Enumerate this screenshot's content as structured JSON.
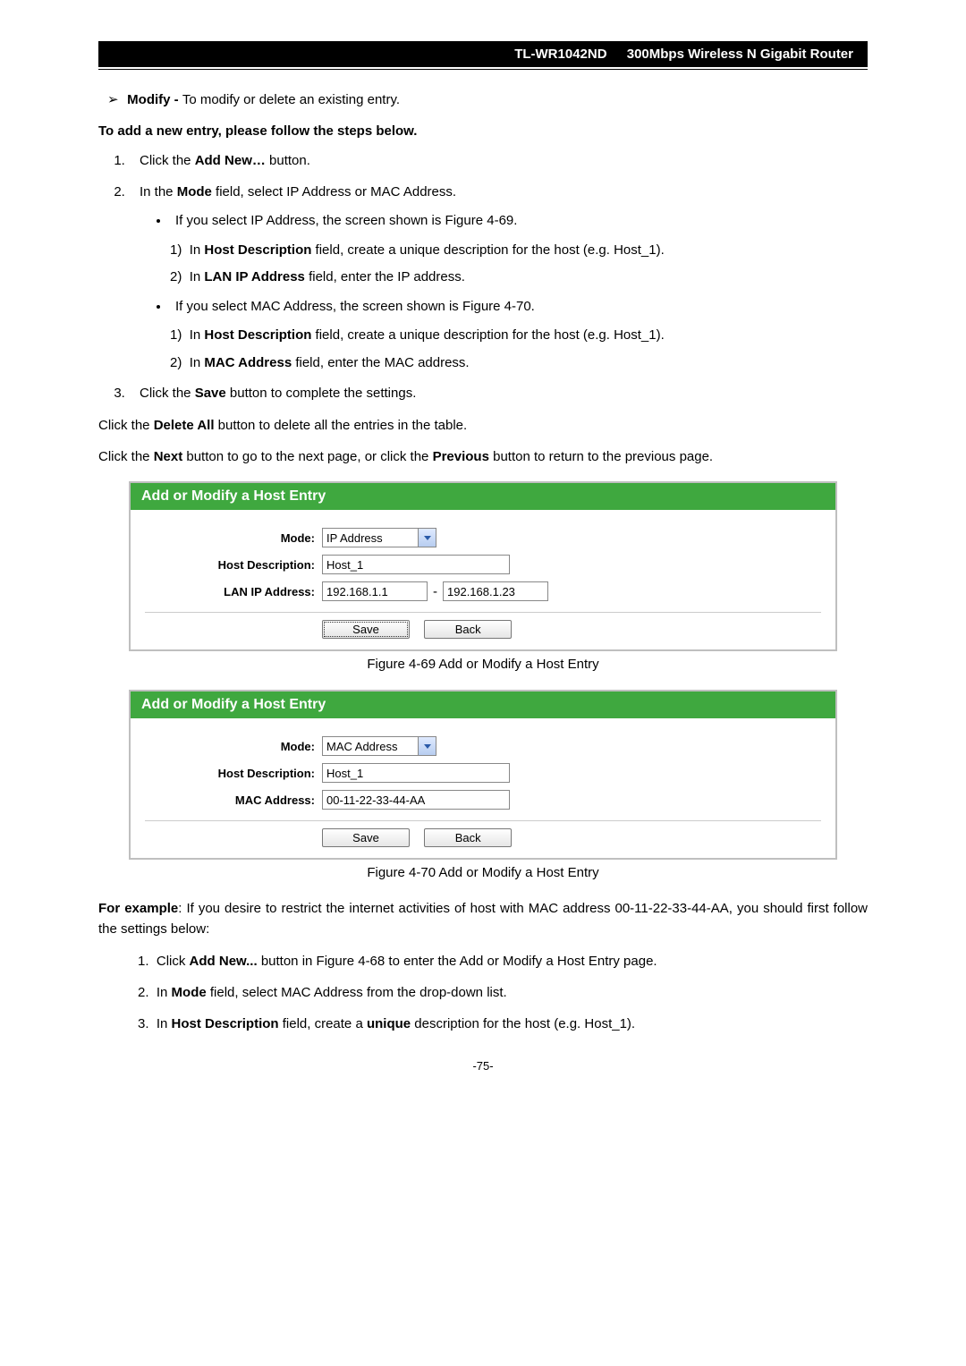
{
  "header": {
    "model": "TL-WR1042ND",
    "product": "300Mbps Wireless N Gigabit Router"
  },
  "modifyLine": {
    "term": "Modify - ",
    "text": "To modify or delete an existing entry."
  },
  "addHeading": "To add a new entry, please follow the steps below.",
  "steps": {
    "s1": {
      "prefix": "Click the ",
      "btn": "Add New…",
      "suffix": " button."
    },
    "s2": {
      "prefix": "In the ",
      "mode": "Mode",
      "suffix": " field, select IP Address or MAC Address."
    },
    "ipBullet": "If you select IP Address, the screen shown is Figure 4-69.",
    "ipSub1": {
      "num": "1)",
      "prefix": "In ",
      "hd": "Host Description",
      "suffix": " field, create a unique description for the host (e.g. Host_1)."
    },
    "ipSub2": {
      "num": "2)",
      "prefix": "In ",
      "lan": "LAN IP Address",
      "suffix": " field, enter the IP address."
    },
    "macBullet": "If you select MAC Address, the screen shown is Figure 4-70.",
    "macSub1": {
      "num": "1)",
      "prefix": "In ",
      "hd": "Host Description",
      "suffix": " field, create a unique description for the host (e.g. Host_1)."
    },
    "macSub2": {
      "num": "2)",
      "prefix": "In ",
      "mac": "MAC Address",
      "suffix": " field, enter the MAC address."
    },
    "s3": {
      "prefix": "Click the ",
      "save": "Save",
      "suffix": " button to complete the settings."
    }
  },
  "deleteAll": {
    "prefix": "Click the ",
    "btn": "Delete All",
    "suffix": " button to delete all the entries in the table."
  },
  "nextPrev": {
    "p1": "Click the ",
    "next": "Next",
    "p2": " button to go to the next page, or click the ",
    "prev": "Previous",
    "p3": " button to return to the previous page."
  },
  "panel1": {
    "title": "Add or Modify a Host Entry",
    "modeLabel": "Mode:",
    "modeValue": "IP Address",
    "hostLabel": "Host Description:",
    "hostValue": "Host_1",
    "lanLabel": "LAN IP Address:",
    "ipFrom": "192.168.1.1",
    "ipTo": "192.168.1.23",
    "save": "Save",
    "back": "Back"
  },
  "fig1Caption": "Figure 4-69    Add or Modify a Host Entry",
  "panel2": {
    "title": "Add or Modify a Host Entry",
    "modeLabel": "Mode:",
    "modeValue": "MAC Address",
    "hostLabel": "Host Description:",
    "hostValue": "Host_1",
    "macLabel": "MAC Address:",
    "macValue": "00-11-22-33-44-AA",
    "save": "Save",
    "back": "Back"
  },
  "fig2Caption": "Figure 4-70    Add or Modify a Host Entry",
  "example": {
    "lead": "For example",
    "text": ": If you desire to restrict the internet activities of host with MAC address 00-11-22-33-44-AA, you should first follow the settings below:"
  },
  "exSteps": {
    "e1": {
      "num": "1.",
      "p1": "Click ",
      "btn": "Add New...",
      "p2": " button in Figure 4-68 to enter the Add or Modify a Host Entry page."
    },
    "e2": {
      "num": "2.",
      "p1": "In ",
      "mode": "Mode",
      "p2": " field, select MAC Address from the drop-down list."
    },
    "e3": {
      "num": "3.",
      "p1": "In ",
      "hd": "Host Description",
      "p2": " field, create a ",
      "uni": "unique",
      "p3": " description for the host (e.g. Host_1)."
    }
  },
  "pageNum": "-75-"
}
